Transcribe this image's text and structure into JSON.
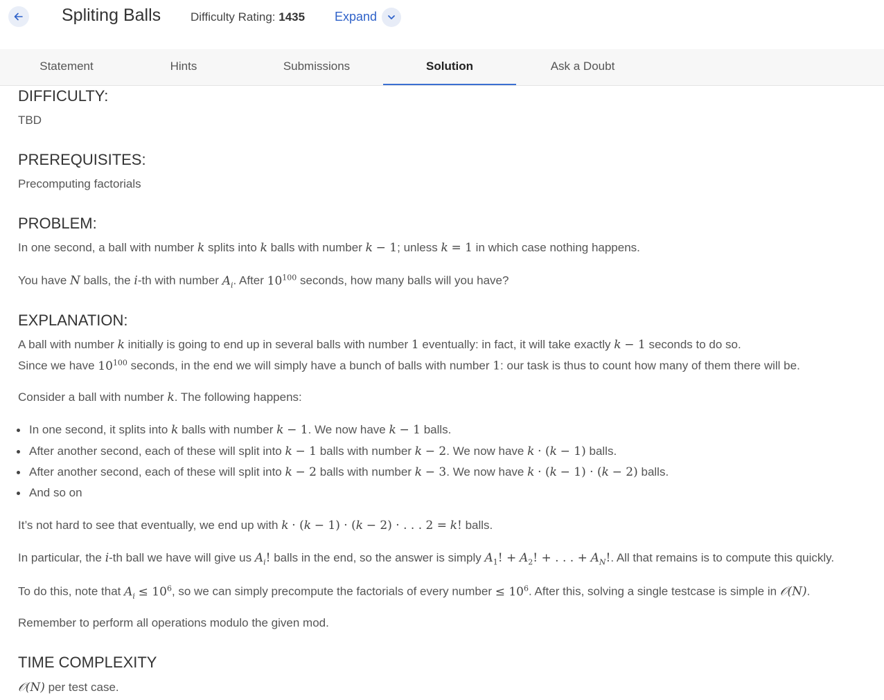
{
  "header": {
    "title": "Spliting Balls",
    "rating_label": "Difficulty Rating:",
    "rating_value": "1435",
    "expand_label": "Expand"
  },
  "tabs": [
    "Statement",
    "Hints",
    "Submissions",
    "Solution",
    "Ask a Doubt"
  ],
  "active_tab": "Solution",
  "sections": {
    "difficulty_heading": "DIFFICULTY:",
    "difficulty_text": "TBD",
    "prereq_heading": "PREREQUISITES:",
    "prereq_text": "Precomputing factorials",
    "problem_heading": "PROBLEM:",
    "explanation_heading": "EXPLANATION:",
    "time_heading": "TIME COMPLEXITY",
    "remember": "Remember to perform all operations modulo the given mod."
  }
}
